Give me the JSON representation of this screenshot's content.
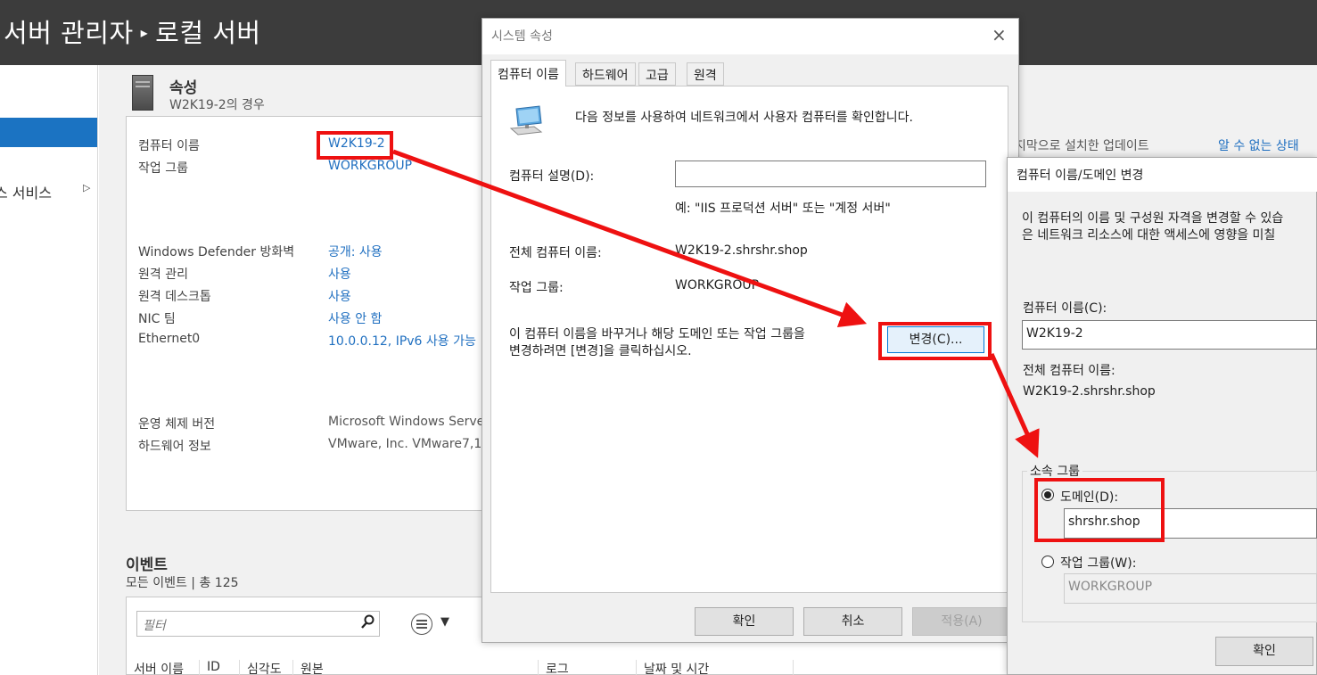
{
  "server_manager": {
    "breadcrumb": {
      "part1": "서버 관리자",
      "separator": "▸",
      "part2": "로컬 서버"
    },
    "nav": {
      "item_services": "스 서비스",
      "item_arrow": "▷"
    },
    "properties": {
      "title": "속성",
      "subtitle": "W2K19-2의 경우",
      "rows": [
        {
          "label": "컴퓨터 이름",
          "value": "W2K19-2"
        },
        {
          "label": "작업 그룹",
          "value": "WORKGROUP"
        },
        {
          "label": "Windows Defender 방화벽",
          "value": "공개: 사용"
        },
        {
          "label": "원격 관리",
          "value": "사용"
        },
        {
          "label": "원격 데스크톱",
          "value": "사용"
        },
        {
          "label": "NIC 팀",
          "value": "사용 안 함"
        },
        {
          "label": "Ethernet0",
          "value": "10.0.0.12, IPv6 사용 가능"
        },
        {
          "label": "운영 체제 버전",
          "value": "Microsoft Windows Serve"
        },
        {
          "label": "하드웨어 정보",
          "value": "VMware, Inc. VMware7,1"
        }
      ],
      "right_label": "지막으로 설치한 업데이트",
      "right_value": "알 수 없는 상태"
    },
    "events": {
      "title": "이벤트",
      "subtitle": "모든 이벤트 | 총 125",
      "filter_placeholder": "필터",
      "columns": [
        "서버 이름",
        "ID",
        "심각도",
        "원본",
        "로그",
        "날짜 및 시간"
      ]
    }
  },
  "system_properties": {
    "title": "시스템 속성",
    "close": "×",
    "tabs": [
      "컴퓨터 이름",
      "하드웨어",
      "고급",
      "원격"
    ],
    "intro": "다음 정보를 사용하여 네트워크에서 사용자 컴퓨터를 확인합니다.",
    "description_label": "컴퓨터 설명(D):",
    "description_value": "",
    "example": "예: \"IIS 프로덕션 서버\" 또는 \"계정 서버\"",
    "full_name_label": "전체 컴퓨터 이름:",
    "full_name_value": "W2K19-2.shrshr.shop",
    "workgroup_label": "작업 그룹:",
    "workgroup_value": "WORKGROUP",
    "change_hint_line1": "이 컴퓨터 이름을 바꾸거나 해당 도메인 또는 작업 그룹을",
    "change_hint_line2": "변경하려면 [변경]을 클릭하십시오.",
    "change_button": "변경(C)...",
    "ok": "확인",
    "cancel": "취소",
    "apply": "적용(A)"
  },
  "name_change": {
    "title": "컴퓨터 이름/도메인 변경",
    "intro_line1": "이 컴퓨터의 이름 및 구성원 자격을 변경할 수 있습",
    "intro_line2": "은 네트워크 리소스에 대한 액세스에 영향을 미칠",
    "name_label": "컴퓨터 이름(C):",
    "name_value": "W2K19-2",
    "full_name_label": "전체 컴퓨터 이름:",
    "full_name_value": "W2K19-2.shrshr.shop",
    "member_of": "소속 그룹",
    "domain_label": "도메인(D):",
    "domain_value": "shrshr.shop",
    "workgroup_label": "작업 그룹(W):",
    "workgroup_value": "WORKGROUP",
    "ok": "확인"
  },
  "colors": {
    "header": "#3c3c3c",
    "accent": "#1b73c2",
    "link": "#1f6fc0",
    "annotation": "#ee1111"
  }
}
